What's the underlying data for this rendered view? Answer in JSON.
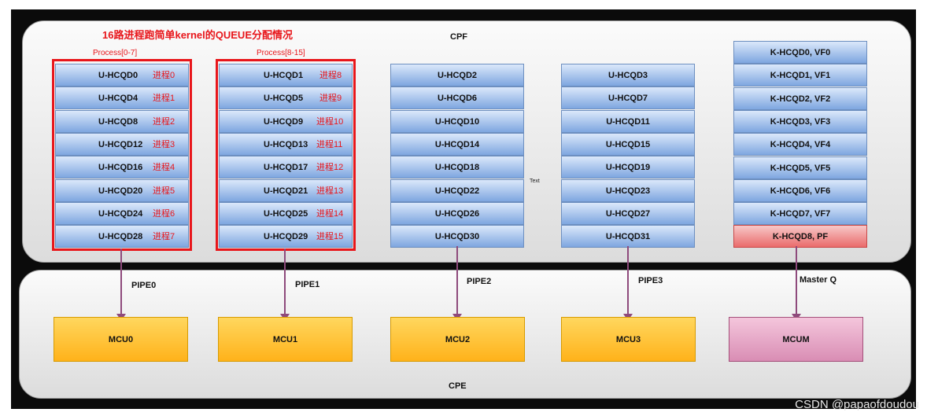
{
  "title": "16路进程跑简单kernel的QUEUE分配情况",
  "cpf_label": "CPF",
  "cpe_label": "CPE",
  "stray_text": "Text",
  "watermark": "CSDN @papaofdoudou",
  "groups": [
    {
      "label": "Process[0-7]",
      "queues": [
        "U-HCQD0",
        "U-HCQD4",
        "U-HCQD8",
        "U-HCQD12",
        "U-HCQD16",
        "U-HCQD20",
        "U-HCQD24",
        "U-HCQD28"
      ],
      "procs": [
        "进程0",
        "进程1",
        "进程2",
        "进程3",
        "进程4",
        "进程5",
        "进程6",
        "进程7"
      ]
    },
    {
      "label": "Process[8-15]",
      "queues": [
        "U-HCQD1",
        "U-HCQD5",
        "U-HCQD9",
        "U-HCQD13",
        "U-HCQD17",
        "U-HCQD21",
        "U-HCQD25",
        "U-HCQD29"
      ],
      "procs": [
        "进程8",
        "进程9",
        "进程10",
        "进程11",
        "进程12",
        "进程13",
        "进程14",
        "进程15"
      ]
    },
    {
      "queues": [
        "U-HCQD2",
        "U-HCQD6",
        "U-HCQD10",
        "U-HCQD14",
        "U-HCQD18",
        "U-HCQD22",
        "U-HCQD26",
        "U-HCQD30"
      ]
    },
    {
      "queues": [
        "U-HCQD3",
        "U-HCQD7",
        "U-HCQD11",
        "U-HCQD15",
        "U-HCQD19",
        "U-HCQD23",
        "U-HCQD27",
        "U-HCQD31"
      ]
    }
  ],
  "kernel_queues": [
    "K-HCQD0, VF0",
    "K-HCQD1, VF1",
    "K-HCQD2, VF2",
    "K-HCQD3, VF3",
    "K-HCQD4, VF4",
    "K-HCQD5, VF5",
    "K-HCQD6, VF6",
    "K-HCQD7, VF7",
    "K-HCQD8, PF"
  ],
  "pipes": [
    "PIPE0",
    "PIPE1",
    "PIPE2",
    "PIPE3",
    "Master Q"
  ],
  "mcus": [
    "MCU0",
    "MCU1",
    "MCU2",
    "MCU3",
    "MCUM"
  ],
  "colors": {
    "accent_red": "#e8161b",
    "queue_blue": "#7ea6e0",
    "mcu_orange": "#ffb21a",
    "mcum_pink": "#d98db4",
    "pf_red": "#ea6b6b",
    "arrow": "#8e4a7c"
  }
}
